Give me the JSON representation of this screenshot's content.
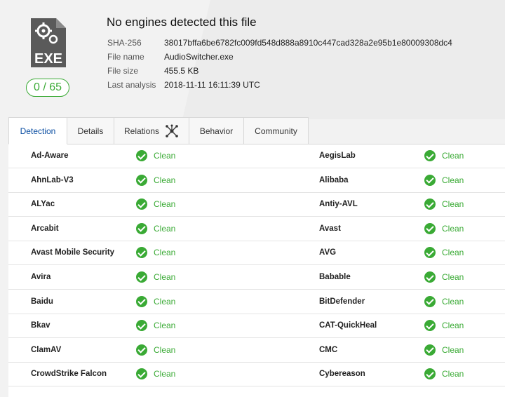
{
  "header": {
    "file_type": "EXE",
    "score": "0 / 65",
    "title": "No engines detected this file",
    "meta": [
      {
        "label": "SHA-256",
        "value": "38017bffa6be6782fc009fd548d888a8910c447cad328a2e95b1e80009308dc4"
      },
      {
        "label": "File name",
        "value": "AudioSwitcher.exe"
      },
      {
        "label": "File size",
        "value": "455.5 KB"
      },
      {
        "label": "Last analysis",
        "value": "2018-11-11 16:11:39 UTC"
      }
    ]
  },
  "tabs": [
    "Detection",
    "Details",
    "Relations",
    "Behavior",
    "Community"
  ],
  "status_label": "Clean",
  "status_color": "#3aaa35",
  "rows": [
    {
      "left": "Ad-Aware",
      "right": "AegisLab"
    },
    {
      "left": "AhnLab-V3",
      "right": "Alibaba"
    },
    {
      "left": "ALYac",
      "right": "Antiy-AVL"
    },
    {
      "left": "Arcabit",
      "right": "Avast"
    },
    {
      "left": "Avast Mobile Security",
      "right": "AVG"
    },
    {
      "left": "Avira",
      "right": "Babable"
    },
    {
      "left": "Baidu",
      "right": "BitDefender"
    },
    {
      "left": "Bkav",
      "right": "CAT-QuickHeal"
    },
    {
      "left": "ClamAV",
      "right": "CMC"
    },
    {
      "left": "CrowdStrike Falcon",
      "right": "Cybereason"
    }
  ]
}
